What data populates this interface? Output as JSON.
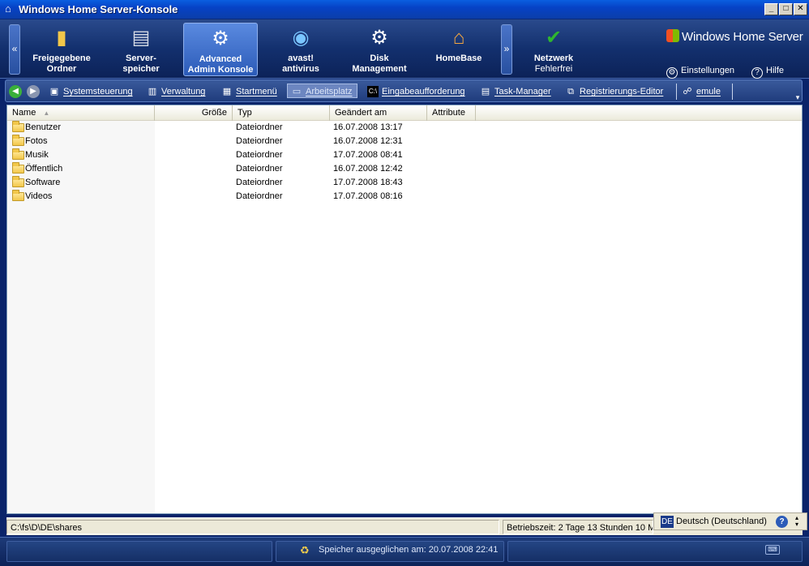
{
  "window": {
    "title": "Windows Home Server-Konsole",
    "minimize": "_",
    "maximize": "□",
    "close": "✕"
  },
  "ribbon": {
    "left_arrow": "«",
    "right_arrow": "»",
    "tabs": [
      {
        "line1": "Freigegebene",
        "line2": "Ordner",
        "icon": "shared-folders-icon"
      },
      {
        "line1": "Server-",
        "line2": "speicher",
        "icon": "server-storage-icon"
      },
      {
        "line1": "Advanced",
        "line2": "Admin Konsole",
        "icon": "admin-console-icon",
        "active": true
      },
      {
        "line1": "avast!",
        "line2": "antivirus",
        "icon": "avast-icon"
      },
      {
        "line1": "Disk",
        "line2": "Management",
        "icon": "gear-icon"
      },
      {
        "line1": "HomeBase",
        "line2": "",
        "icon": "homebase-icon"
      }
    ],
    "network": {
      "line1": "Netzwerk",
      "line2": "Fehlerfrei",
      "status_color": "#2fb52f"
    },
    "brand": "Windows Home Server",
    "settings": "Einstellungen",
    "help": "Hilfe"
  },
  "quickbar": {
    "items": [
      {
        "label": "Systemsteuerung",
        "icon": "control-panel-icon"
      },
      {
        "label": "Verwaltung",
        "icon": "admin-tools-icon"
      },
      {
        "label": "Startmenü",
        "icon": "start-menu-icon"
      },
      {
        "label": "Arbeitsplatz",
        "icon": "my-computer-icon",
        "selected": true
      },
      {
        "label": "Eingabeaufforderung",
        "icon": "command-prompt-icon"
      },
      {
        "label": "Task-Manager",
        "icon": "task-manager-icon"
      },
      {
        "label": "Registrierungs-Editor",
        "icon": "registry-editor-icon"
      },
      {
        "label": "emule",
        "icon": "emule-icon"
      }
    ]
  },
  "explorer": {
    "columns": [
      "Name",
      "Größe",
      "Typ",
      "Geändert am",
      "Attribute"
    ],
    "rows": [
      {
        "name": "Benutzer",
        "size": "",
        "type": "Dateiordner",
        "modified": "16.07.2008 13:17",
        "attributes": ""
      },
      {
        "name": "Fotos",
        "size": "",
        "type": "Dateiordner",
        "modified": "16.07.2008 12:31",
        "attributes": ""
      },
      {
        "name": "Musik",
        "size": "",
        "type": "Dateiordner",
        "modified": "17.07.2008 08:41",
        "attributes": ""
      },
      {
        "name": "Öffentlich",
        "size": "",
        "type": "Dateiordner",
        "modified": "16.07.2008 12:42",
        "attributes": ""
      },
      {
        "name": "Software",
        "size": "",
        "type": "Dateiordner",
        "modified": "17.07.2008 18:43",
        "attributes": ""
      },
      {
        "name": "Videos",
        "size": "",
        "type": "Dateiordner",
        "modified": "17.07.2008 08:16",
        "attributes": ""
      }
    ]
  },
  "statusbar": {
    "path": "C:\\fs\\D\\DE\\shares",
    "uptime": "Betriebszeit: 2 Tage 13 Stunden 10 M..."
  },
  "langbar": {
    "code": "DE",
    "language": "Deutsch (Deutschland)",
    "help": "?"
  },
  "bottombar": {
    "message": "Speicher ausgeglichen am: 20.07.2008 22:41"
  }
}
